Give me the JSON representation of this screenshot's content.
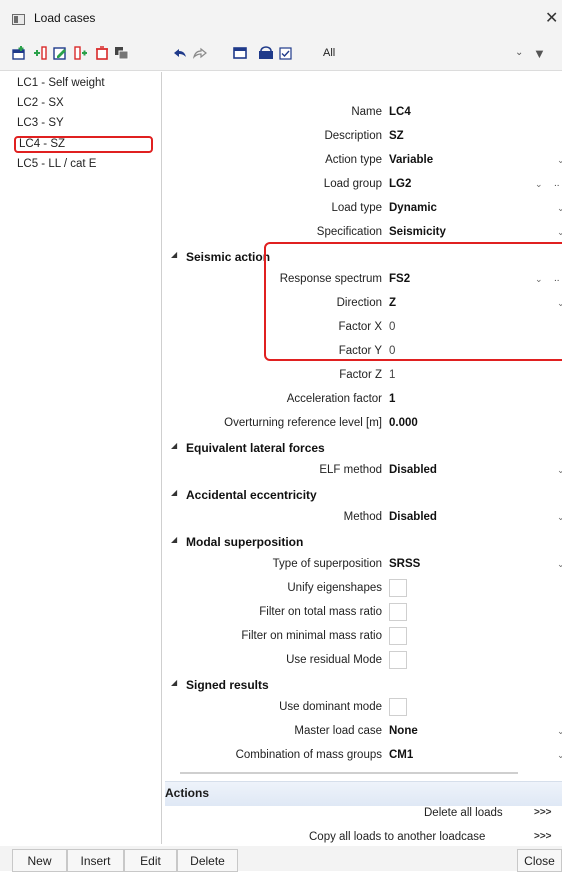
{
  "window": {
    "title": "Load cases",
    "close_glyph": "✕"
  },
  "toolbar": {
    "filter_value": "All",
    "icons": [
      "new-icon",
      "insert-icon",
      "edit-icon",
      "copy-icon",
      "delete-icon",
      "duplicate-icon",
      "undo-icon",
      "redo-icon",
      "table-icon",
      "save-icon",
      "checkbox-icon"
    ],
    "dropdown_glyph": "⌄",
    "filter_glyph": "▼"
  },
  "load_cases": [
    {
      "label": "LC1 - Self weight"
    },
    {
      "label": "LC2 - SX"
    },
    {
      "label": "LC3 - SY"
    },
    {
      "label": "LC4 - SZ",
      "selected": true
    },
    {
      "label": "LC5 - LL / cat E"
    }
  ],
  "properties": {
    "name": {
      "label": "Name",
      "value": "LC4"
    },
    "description": {
      "label": "Description",
      "value": "SZ"
    },
    "action_type": {
      "label": "Action type",
      "value": "Variable"
    },
    "load_group": {
      "label": "Load group",
      "value": "LG2"
    },
    "load_type": {
      "label": "Load type",
      "value": "Dynamic"
    },
    "specification": {
      "label": "Specification",
      "value": "Seismicity"
    }
  },
  "seismic_action": {
    "header": "Seismic action",
    "response_spectrum": {
      "label": "Response spectrum",
      "value": "FS2"
    },
    "direction": {
      "label": "Direction",
      "value": "Z"
    },
    "factor_x": {
      "label": "Factor X",
      "value": "0"
    },
    "factor_y": {
      "label": "Factor Y",
      "value": "0"
    },
    "factor_z": {
      "label": "Factor Z",
      "value": "1"
    },
    "acceleration_factor": {
      "label": "Acceleration factor",
      "value": "1"
    },
    "overturning": {
      "label": "Overturning reference level [m]",
      "value": "0.000"
    }
  },
  "equivalent_lateral_forces": {
    "header": "Equivalent lateral forces",
    "elf_method": {
      "label": "ELF method",
      "value": "Disabled"
    }
  },
  "accidental_eccentricity": {
    "header": "Accidental eccentricity",
    "method": {
      "label": "Method",
      "value": "Disabled"
    }
  },
  "modal_superposition": {
    "header": "Modal superposition",
    "type": {
      "label": "Type of superposition",
      "value": "SRSS"
    },
    "unify": {
      "label": "Unify eigenshapes",
      "checked": false
    },
    "filter_total": {
      "label": "Filter on total mass ratio",
      "checked": false
    },
    "filter_minimal": {
      "label": "Filter on minimal mass ratio",
      "checked": false
    },
    "residual": {
      "label": "Use residual Mode",
      "checked": false
    }
  },
  "signed_results": {
    "header": "Signed results",
    "dominant": {
      "label": "Use dominant mode",
      "checked": false
    },
    "master": {
      "label": "Master load case",
      "value": "None"
    },
    "combination": {
      "label": "Combination of mass groups",
      "value": "CM1"
    }
  },
  "actions": {
    "header": "Actions",
    "delete_all": "Delete all loads",
    "copy_all": "Copy all loads to another loadcase",
    "go_label": ">>>"
  },
  "buttons": {
    "new": "New",
    "insert": "Insert",
    "edit": "Edit",
    "delete": "Delete",
    "close": "Close"
  },
  "colors": {
    "highlight": "#e02020",
    "section_band": "#dfe8f5"
  }
}
